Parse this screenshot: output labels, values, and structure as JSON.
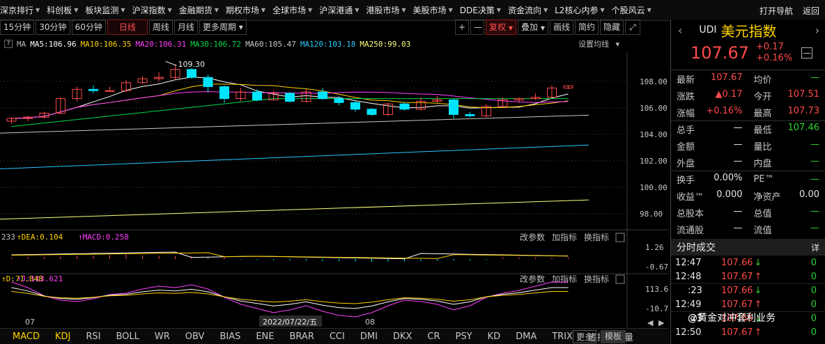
{
  "nav": {
    "items": [
      "深京排行",
      "科创板",
      "板块监测",
      "沪深指数",
      "金融期货",
      "期权市场",
      "全球市场",
      "沪深港通",
      "港股市场",
      "美股市场",
      "DDE决策",
      "资金流向",
      "L2核心内参",
      "个股风云"
    ],
    "open_nav": "打开导航",
    "back": "返回"
  },
  "toolbar": {
    "periods": [
      "15分钟",
      "30分钟",
      "60分钟",
      "日线",
      "周线",
      "月线",
      "更多周期"
    ],
    "active_period": "日线",
    "plus": "+",
    "minus": "—",
    "fuquan": "复权",
    "overlay": "叠加",
    "draw": "画线",
    "simple": "简约",
    "hide": "隐藏"
  },
  "ma": {
    "label": "MA",
    "ma5": "MA5:106.96",
    "ma10": "MA10:106.35",
    "ma20": "MA20:106.31",
    "ma30": "MA30:106.72",
    "ma60": "MA60:105.47",
    "ma120": "MA120:103.18",
    "ma250": "MA250:99.03",
    "settings": "设置均线"
  },
  "chart_data": {
    "type": "candlestick",
    "price_axis": [
      "108.00",
      "106.00",
      "104.00",
      "102.00",
      "100.00",
      "98.00"
    ],
    "peak_label": "109.30",
    "dates": [
      "07",
      "2022/07/22/五",
      "08"
    ],
    "candles": [
      [
        105.0,
        105.3,
        104.8,
        105.2
      ],
      [
        105.2,
        105.4,
        105.0,
        105.3
      ],
      [
        105.3,
        105.7,
        105.2,
        105.6
      ],
      [
        105.6,
        106.8,
        105.5,
        106.7
      ],
      [
        106.7,
        107.6,
        106.5,
        107.4
      ],
      [
        107.4,
        107.7,
        107.1,
        107.3
      ],
      [
        107.3,
        107.6,
        107.2,
        107.3
      ],
      [
        107.3,
        108.1,
        107.2,
        107.9
      ],
      [
        107.9,
        108.4,
        107.8,
        108.2
      ],
      [
        108.2,
        108.7,
        108.0,
        108.3
      ],
      [
        108.3,
        109.3,
        108.1,
        108.9
      ],
      [
        108.9,
        109.0,
        108.2,
        108.3
      ],
      [
        108.3,
        108.5,
        107.2,
        107.6
      ],
      [
        107.6,
        107.7,
        106.4,
        106.7
      ],
      [
        106.7,
        107.5,
        106.5,
        107.2
      ],
      [
        107.2,
        107.4,
        106.5,
        106.6
      ],
      [
        106.6,
        107.3,
        106.6,
        107.1
      ],
      [
        107.1,
        107.2,
        106.4,
        106.5
      ],
      [
        106.5,
        107.4,
        106.4,
        107.2
      ],
      [
        107.2,
        107.5,
        106.6,
        106.7
      ],
      [
        106.7,
        106.9,
        106.2,
        106.4
      ],
      [
        106.4,
        106.6,
        105.7,
        105.9
      ],
      [
        105.9,
        106.0,
        105.4,
        105.5
      ],
      [
        105.5,
        106.4,
        105.4,
        106.3
      ],
      [
        106.3,
        106.4,
        105.8,
        105.9
      ],
      [
        105.9,
        106.8,
        105.8,
        106.5
      ],
      [
        106.5,
        106.9,
        106.4,
        106.6
      ],
      [
        106.6,
        106.7,
        105.2,
        105.5
      ],
      [
        105.5,
        105.7,
        105.3,
        105.4
      ],
      [
        105.4,
        106.3,
        105.3,
        106.1
      ],
      [
        106.1,
        106.8,
        106.0,
        106.6
      ],
      [
        106.6,
        106.8,
        106.4,
        106.7
      ],
      [
        106.7,
        107.1,
        106.6,
        106.8
      ],
      [
        106.8,
        107.7,
        106.8,
        107.5
      ],
      [
        107.5,
        107.7,
        107.4,
        107.67
      ]
    ],
    "macd": {
      "labels": [
        "233",
        "DEA:0.104",
        "MACD:0.258"
      ],
      "axis": [
        "1.26",
        "-0.67"
      ]
    },
    "kdj": {
      "labels": [
        "D:71.848",
        "J:113.621"
      ],
      "axis": [
        "113.62",
        "-10.76"
      ]
    }
  },
  "subpanel": {
    "params": "改参数",
    "add": "加指标",
    "change": "换指标"
  },
  "bottom": {
    "tabs": [
      "MACD",
      "KDJ",
      "RSI",
      "BOLL",
      "WR",
      "OBV",
      "BIAS",
      "ENE",
      "BRAR",
      "CCI",
      "DMI",
      "DKX",
      "CR",
      "PSY",
      "KD",
      "DMA",
      "TRIX",
      "虚拟成交量"
    ],
    "more": "更多",
    "template": "模板"
  },
  "quote": {
    "code": "UDI",
    "name": "美元指数",
    "price": "107.67",
    "change": "+0.17",
    "pct": "+0.16%",
    "rows": [
      [
        "最新",
        "107.67",
        "均价",
        "—"
      ],
      [
        "涨跌",
        "▲0.17",
        "今开",
        "107.51"
      ],
      [
        "涨幅",
        "+0.16%",
        "最高",
        "107.73"
      ],
      [
        "总手",
        "—",
        "最低",
        "107.46"
      ],
      [
        "金额",
        "—",
        "量比",
        "—"
      ],
      [
        "外盘",
        "—",
        "内盘",
        "—"
      ],
      [
        "换手",
        "0.00%",
        "PE™",
        "—"
      ],
      [
        "收益™",
        "0.000",
        "净资产",
        "0.00"
      ],
      [
        "总股本",
        "—",
        "总值",
        "—"
      ],
      [
        "流通股",
        "—",
        "流值",
        "—"
      ]
    ],
    "ticks_title": "分时成交",
    "ticks_detail": "详",
    "ticks": [
      [
        "12:47",
        "107.66",
        "↓",
        "0"
      ],
      [
        "12:48",
        "107.67",
        "↑",
        "0"
      ],
      [
        ":23",
        "107.66",
        "↓",
        "0"
      ],
      [
        "12:49",
        "107.67",
        "↑",
        "0"
      ],
      [
        ":23",
        "107.66",
        "↓",
        "0"
      ],
      [
        "12:50",
        "107.67",
        "↑",
        "0"
      ]
    ],
    "watermark": "@黄金对冲套利业务"
  }
}
